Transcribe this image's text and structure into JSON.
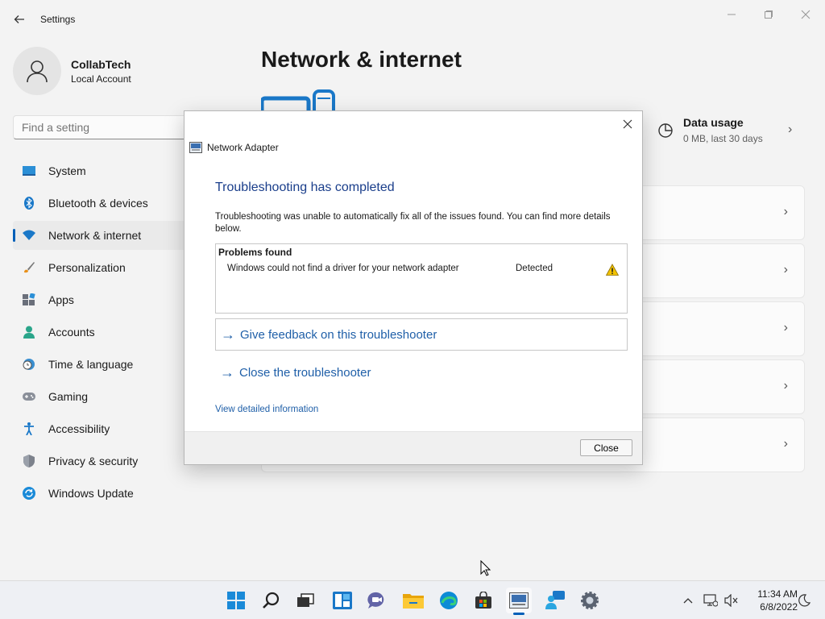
{
  "window": {
    "title": "Settings",
    "back_icon": "back-arrow-icon",
    "controls": [
      "minimize-icon",
      "maximize-icon",
      "close-icon"
    ]
  },
  "profile": {
    "name": "CollabTech",
    "account_type": "Local Account"
  },
  "search": {
    "placeholder": "Find a setting"
  },
  "nav": {
    "items": [
      {
        "label": "System",
        "icon": "monitor-icon"
      },
      {
        "label": "Bluetooth & devices",
        "icon": "bluetooth-icon"
      },
      {
        "label": "Network & internet",
        "icon": "wifi-icon",
        "active": true
      },
      {
        "label": "Personalization",
        "icon": "brush-icon"
      },
      {
        "label": "Apps",
        "icon": "apps-icon"
      },
      {
        "label": "Accounts",
        "icon": "person-icon"
      },
      {
        "label": "Time & language",
        "icon": "clock-globe-icon"
      },
      {
        "label": "Gaming",
        "icon": "gamepad-icon"
      },
      {
        "label": "Accessibility",
        "icon": "accessibility-icon"
      },
      {
        "label": "Privacy & security",
        "icon": "shield-icon"
      },
      {
        "label": "Windows Update",
        "icon": "update-icon"
      }
    ]
  },
  "main": {
    "title": "Network & internet",
    "data_usage": {
      "title": "Data usage",
      "subtitle": "0 MB, last 30 days"
    }
  },
  "dialog": {
    "window_title": "Network Adapter",
    "heading": "Troubleshooting has completed",
    "description": "Troubleshooting was unable to automatically fix all of the issues found. You can find more details below.",
    "problems": {
      "title": "Problems found",
      "items": [
        {
          "text": "Windows could not find a driver for your network adapter",
          "status": "Detected",
          "icon": "warning-icon"
        }
      ]
    },
    "feedback_link": "Give feedback on this troubleshooter",
    "close_troubleshooter_link": "Close the troubleshooter",
    "details_link": "View detailed information",
    "close_button": "Close"
  },
  "taskbar": {
    "apps": [
      "start-icon",
      "search-icon",
      "task-view-icon",
      "widgets-icon",
      "chat-icon",
      "file-explorer-icon",
      "edge-icon",
      "store-icon",
      "troubleshooter-icon",
      "get-help-icon",
      "settings-icon"
    ],
    "tray": [
      "chevron-up-icon",
      "network-icon",
      "volume-muted-icon"
    ],
    "time": "11:34 AM",
    "date": "6/8/2022"
  },
  "colors": {
    "accent": "#005fb8",
    "link": "#1f5fa8",
    "heading": "#1a3e8b",
    "warning": "#f2c200"
  }
}
